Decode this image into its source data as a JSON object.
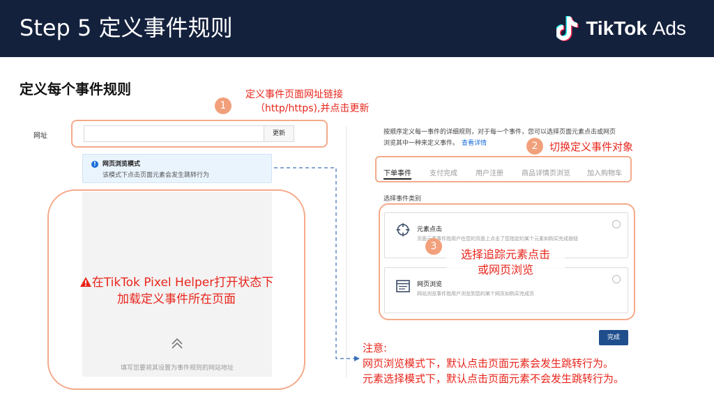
{
  "header": {
    "title": "Step 5 定义事件规则",
    "brand_name": "TikTok",
    "brand_suffix": "Ads"
  },
  "section_title": "定义每个事件规则",
  "steps": [
    {
      "num": "1",
      "line1": "定义事件页面网址链接",
      "line2": "（http/https),并点击更新"
    },
    {
      "num": "2",
      "text": "切换定义事件对象"
    },
    {
      "num": "3",
      "line1": "选择追踪元素点击",
      "line2": "或网页浏览"
    }
  ],
  "url_form": {
    "label": "网址",
    "input_value": "",
    "update_button": "更新"
  },
  "info_box": {
    "title": "网页浏览模式",
    "desc": "该模式下点击页面元素会发生跳转行为"
  },
  "preview": {
    "warning_line1": "在TikTok Pixel Helper打开状态下",
    "warning_line2": "加载定义事件所在页面",
    "hint": "填写您要将其设置为事件规则的网站地址"
  },
  "right_panel": {
    "intro_line1": "按顺序定义每一事件的详细规则，对于每一个事件，您可以选择页面元素点击或网页",
    "intro_line2": "浏览其中一种来定义事件。",
    "details_link": "查看详情",
    "tabs": [
      "下单事件",
      "支付完成",
      "用户注册",
      "商品详情页浏览",
      "加入购物车"
    ],
    "active_tab": 0,
    "category_label": "选择事件类别",
    "options": [
      {
        "title": "元素点击",
        "desc": "页面元素事件指用户在您的页面上点击了您指定的某个元素如购买完成按钮"
      },
      {
        "title": "网页浏览",
        "desc": "网站浏览事件指用户浏览到您的某个网页如购买完成页"
      }
    ],
    "done_button": "完成"
  },
  "note": {
    "title": "注意:",
    "line1": "网页浏览模式下，默认点击页面元素会发生跳转行为。",
    "line2": "元素选择模式下，默认点击页面元素不会发生跳转行为。"
  },
  "colors": {
    "header_bg": "#14213d",
    "accent_red": "#e8251b",
    "highlight_orange": "#f5a98a",
    "link_blue": "#1a6dd8",
    "button_navy": "#1f4e8c"
  }
}
